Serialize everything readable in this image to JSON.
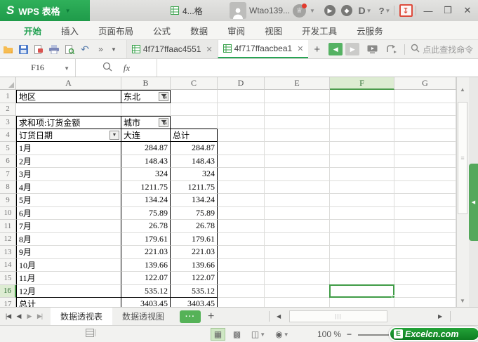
{
  "colors": {
    "accent_green": "#27a454",
    "selection_green": "#3f9c46",
    "danger_red": "#dd4b3c"
  },
  "titlebar": {
    "logo_text": "S",
    "app_name": "WPS 表格",
    "doc_tab_label": "4...格",
    "username": "Wtao139...",
    "docer_glyph": "D",
    "help_glyph": "?"
  },
  "menu": {
    "active_tab": "开始",
    "tabs": [
      "开始",
      "插入",
      "页面布局",
      "公式",
      "数据",
      "审阅",
      "视图",
      "开发工具",
      "云服务"
    ]
  },
  "toolbar": {
    "doc_tabs": [
      {
        "label": "4f717ffaac4551",
        "active": false
      },
      {
        "label": "4f717ffaacbea1",
        "active": true
      }
    ],
    "find_hint": "点此查找命令"
  },
  "formula_bar": {
    "name_box_value": "F16",
    "fx_label": "fx",
    "formula_value": ""
  },
  "grid": {
    "columns": [
      "A",
      "B",
      "C",
      "D",
      "E",
      "F",
      "G"
    ],
    "selected_column": "F",
    "selected_row": 16,
    "selected_cell": "F16",
    "rows": [
      {
        "n": 1,
        "cells": {
          "A": "地区",
          "B": "东北"
        },
        "filter_cols": [
          "B"
        ]
      },
      {
        "n": 2,
        "cells": {}
      },
      {
        "n": 3,
        "cells": {
          "A": "求和项:订货金额",
          "B": "城市"
        },
        "filter_cols": [
          "B"
        ]
      },
      {
        "n": 4,
        "cells": {
          "A": "订货日期",
          "B": "大连",
          "C": "总计"
        },
        "dropdown_cols": [
          "A"
        ]
      },
      {
        "n": 5,
        "cells": {
          "A": "1月",
          "B": "284.87",
          "C": "284.87"
        }
      },
      {
        "n": 6,
        "cells": {
          "A": "2月",
          "B": "148.43",
          "C": "148.43"
        }
      },
      {
        "n": 7,
        "cells": {
          "A": "3月",
          "B": "324",
          "C": "324"
        }
      },
      {
        "n": 8,
        "cells": {
          "A": "4月",
          "B": "1211.75",
          "C": "1211.75"
        }
      },
      {
        "n": 9,
        "cells": {
          "A": "5月",
          "B": "134.24",
          "C": "134.24"
        }
      },
      {
        "n": 10,
        "cells": {
          "A": "6月",
          "B": "75.89",
          "C": "75.89"
        }
      },
      {
        "n": 11,
        "cells": {
          "A": "7月",
          "B": "26.78",
          "C": "26.78"
        }
      },
      {
        "n": 12,
        "cells": {
          "A": "8月",
          "B": "179.61",
          "C": "179.61"
        }
      },
      {
        "n": 13,
        "cells": {
          "A": "9月",
          "B": "221.03",
          "C": "221.03"
        }
      },
      {
        "n": 14,
        "cells": {
          "A": "10月",
          "B": "139.66",
          "C": "139.66"
        }
      },
      {
        "n": 15,
        "cells": {
          "A": "11月",
          "B": "122.07",
          "C": "122.07"
        }
      },
      {
        "n": 16,
        "cells": {
          "A": "12月",
          "B": "535.12",
          "C": "535.12"
        }
      },
      {
        "n": 17,
        "cells": {
          "A": "总计",
          "B": "3403.45",
          "C": "3403.45"
        }
      }
    ]
  },
  "sheet_bar": {
    "tabs": [
      {
        "label": "数据透视表",
        "active": true
      },
      {
        "label": "数据透视图",
        "active": false
      }
    ]
  },
  "status_bar": {
    "zoom_level": "100 %",
    "watermark_logo": "E",
    "watermark_text": "Excelcn.com"
  }
}
